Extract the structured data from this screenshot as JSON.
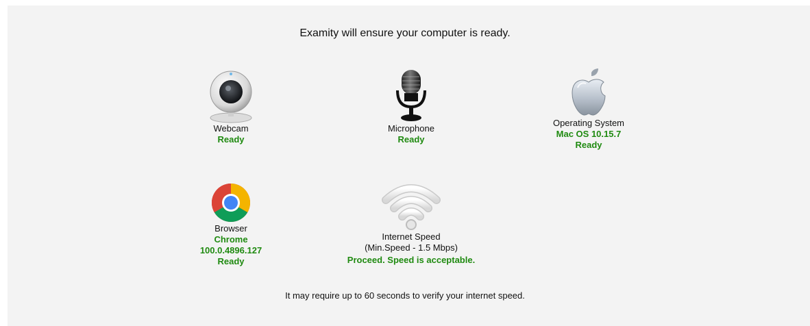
{
  "header": {
    "title": "Examity will ensure your computer is ready."
  },
  "checks": {
    "webcam": {
      "icon": "webcam-icon",
      "label": "Webcam",
      "status": "Ready"
    },
    "microphone": {
      "icon": "microphone-icon",
      "label": "Microphone",
      "status": "Ready"
    },
    "os": {
      "icon": "apple-icon",
      "label": "Operating System",
      "value": "Mac OS 10.15.7",
      "status": "Ready"
    },
    "browser": {
      "icon": "chrome-icon",
      "label": "Browser",
      "value": "Chrome",
      "version": "100.0.4896.127",
      "status": "Ready"
    },
    "speed": {
      "icon": "wifi-icon",
      "label": "Internet Speed",
      "requirement": "(Min.Speed - 1.5 Mbps)",
      "status": "Proceed. Speed is acceptable."
    }
  },
  "footer": {
    "note": "It may require up to 60 seconds to verify your internet speed."
  },
  "colors": {
    "status_green": "#1f8a10",
    "panel_bg": "#f3f3f3"
  }
}
